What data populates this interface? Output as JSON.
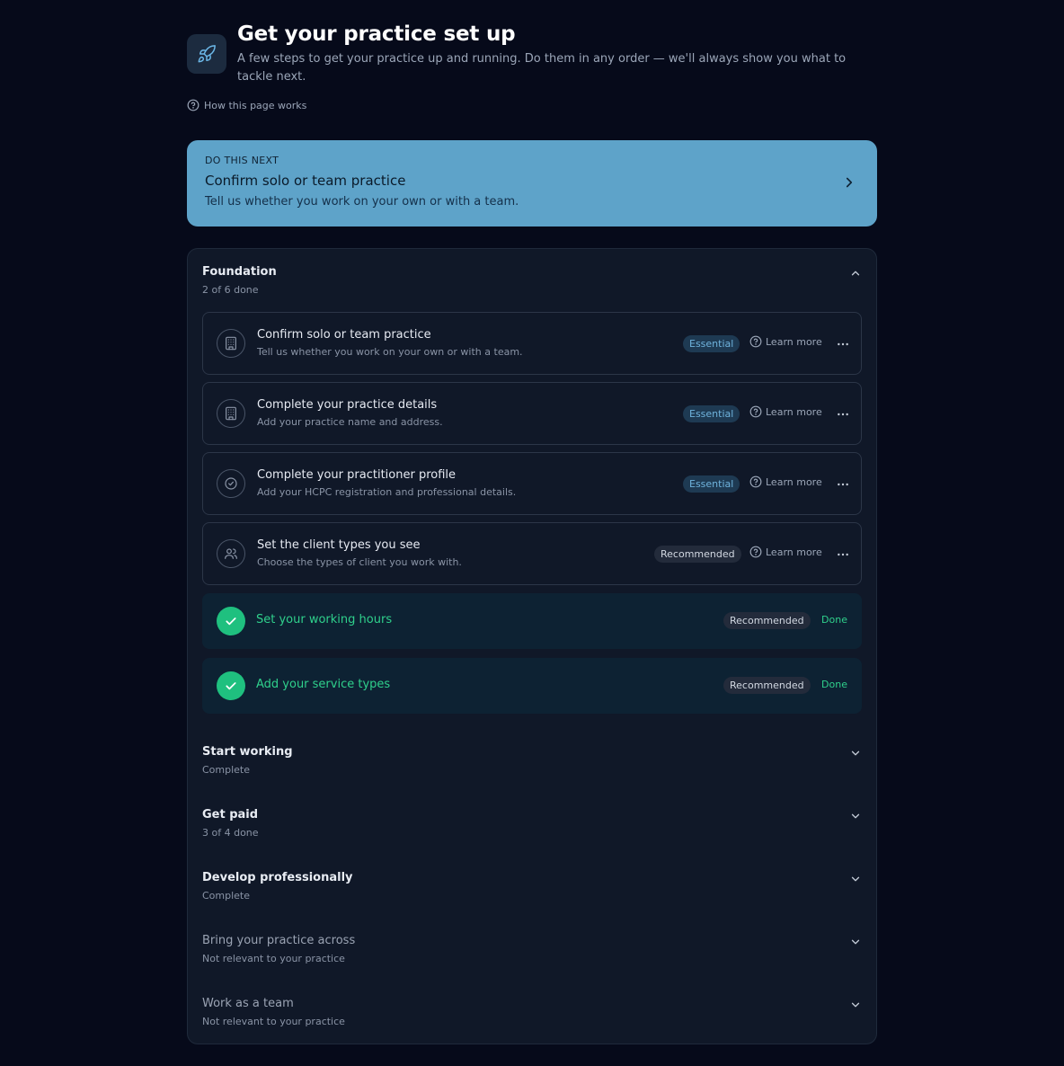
{
  "header": {
    "title": "Get your practice set up",
    "subtitle": "A few steps to get your practice up and running. Do them in any order — we'll always show you what to tackle next.",
    "help_link": "How this page works",
    "icon": "rocket-icon"
  },
  "next_card": {
    "eyebrow": "DO THIS NEXT",
    "title": "Confirm solo or team practice",
    "description": "Tell us whether you work on your own or with a team."
  },
  "foundation": {
    "title": "Foundation",
    "progress": "2 of 6 done",
    "tasks": [
      {
        "title": "Confirm solo or team practice",
        "description": "Tell us whether you work on your own or with a team.",
        "badge": "Essential",
        "learn": "Learn more",
        "icon": "building-icon"
      },
      {
        "title": "Complete your practice details",
        "description": "Add your practice name and address.",
        "badge": "Essential",
        "learn": "Learn more",
        "icon": "building-icon"
      },
      {
        "title": "Complete your practitioner profile",
        "description": "Add your HCPC registration and professional details.",
        "badge": "Essential",
        "learn": "Learn more",
        "icon": "badge-check-icon"
      },
      {
        "title": "Set the client types you see",
        "description": "Choose the types of client you work with.",
        "badge": "Recommended",
        "learn": "Learn more",
        "icon": "users-icon"
      }
    ],
    "done_tasks": [
      {
        "title": "Set your working hours",
        "badge": "Recommended",
        "status": "Done"
      },
      {
        "title": "Add your service types",
        "badge": "Recommended",
        "status": "Done"
      }
    ]
  },
  "sections": [
    {
      "title": "Start working",
      "status": "Complete"
    },
    {
      "title": "Get paid",
      "status": "3 of 4 done"
    },
    {
      "title": "Develop professionally",
      "status": "Complete"
    },
    {
      "title": "Bring your practice across",
      "status": "Not relevant to your practice"
    },
    {
      "title": "Work as a team",
      "status": "Not relevant to your practice"
    }
  ],
  "colors": {
    "background": "#060a1a",
    "panel": "#101828",
    "next_card": "#5ea3c9",
    "success": "#1fc07f",
    "essential_badge": "#1e3a53"
  }
}
